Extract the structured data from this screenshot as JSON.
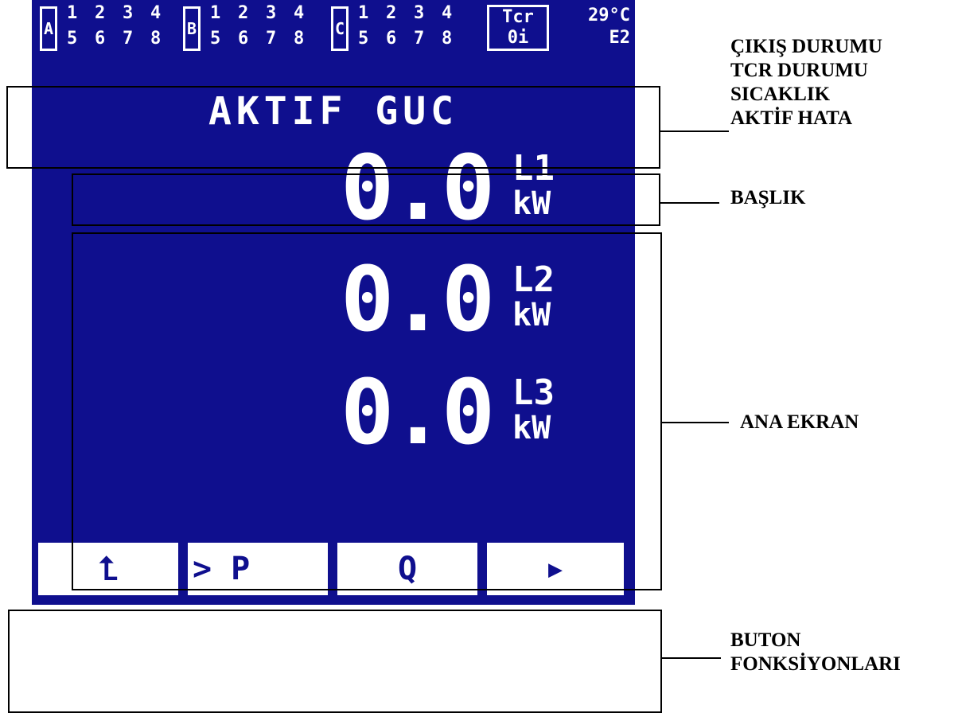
{
  "display": {
    "groups": [
      {
        "label": "A",
        "top": [
          "1",
          "2",
          "3",
          "4"
        ],
        "bottom": [
          "5",
          "6",
          "7",
          "8"
        ]
      },
      {
        "label": "B",
        "top": [
          "1",
          "2",
          "3",
          "4"
        ],
        "bottom": [
          "5",
          "6",
          "7",
          "8"
        ]
      },
      {
        "label": "C",
        "top": [
          "1",
          "2",
          "3",
          "4"
        ],
        "bottom": [
          "5",
          "6",
          "7",
          "8"
        ]
      }
    ],
    "tcr": {
      "line1": "Tcr",
      "line2": "0i"
    },
    "temperature": "29°C",
    "error": "E2",
    "title": "AKTIF GUC",
    "rows": [
      {
        "value": "0.0",
        "phase": "L1",
        "unit": "kW"
      },
      {
        "value": "0.0",
        "phase": "L2",
        "unit": "kW"
      },
      {
        "value": "0.0",
        "phase": "L3",
        "unit": "kW"
      }
    ],
    "buttons": [
      "⮤",
      "> P",
      "Q",
      "▶"
    ]
  },
  "annotations": {
    "status": [
      "ÇIKIŞ DURUMU",
      "TCR DURUMU",
      "SICAKLIK",
      "AKTİF HATA"
    ],
    "header": "BAŞLIK",
    "main": "ANA EKRAN",
    "buttons": [
      "BUTON",
      "FONKSİYONLARI"
    ]
  },
  "colors": {
    "screen_bg": "#0f0f8e",
    "foreground": "#ffffff",
    "frame": "#000000"
  }
}
